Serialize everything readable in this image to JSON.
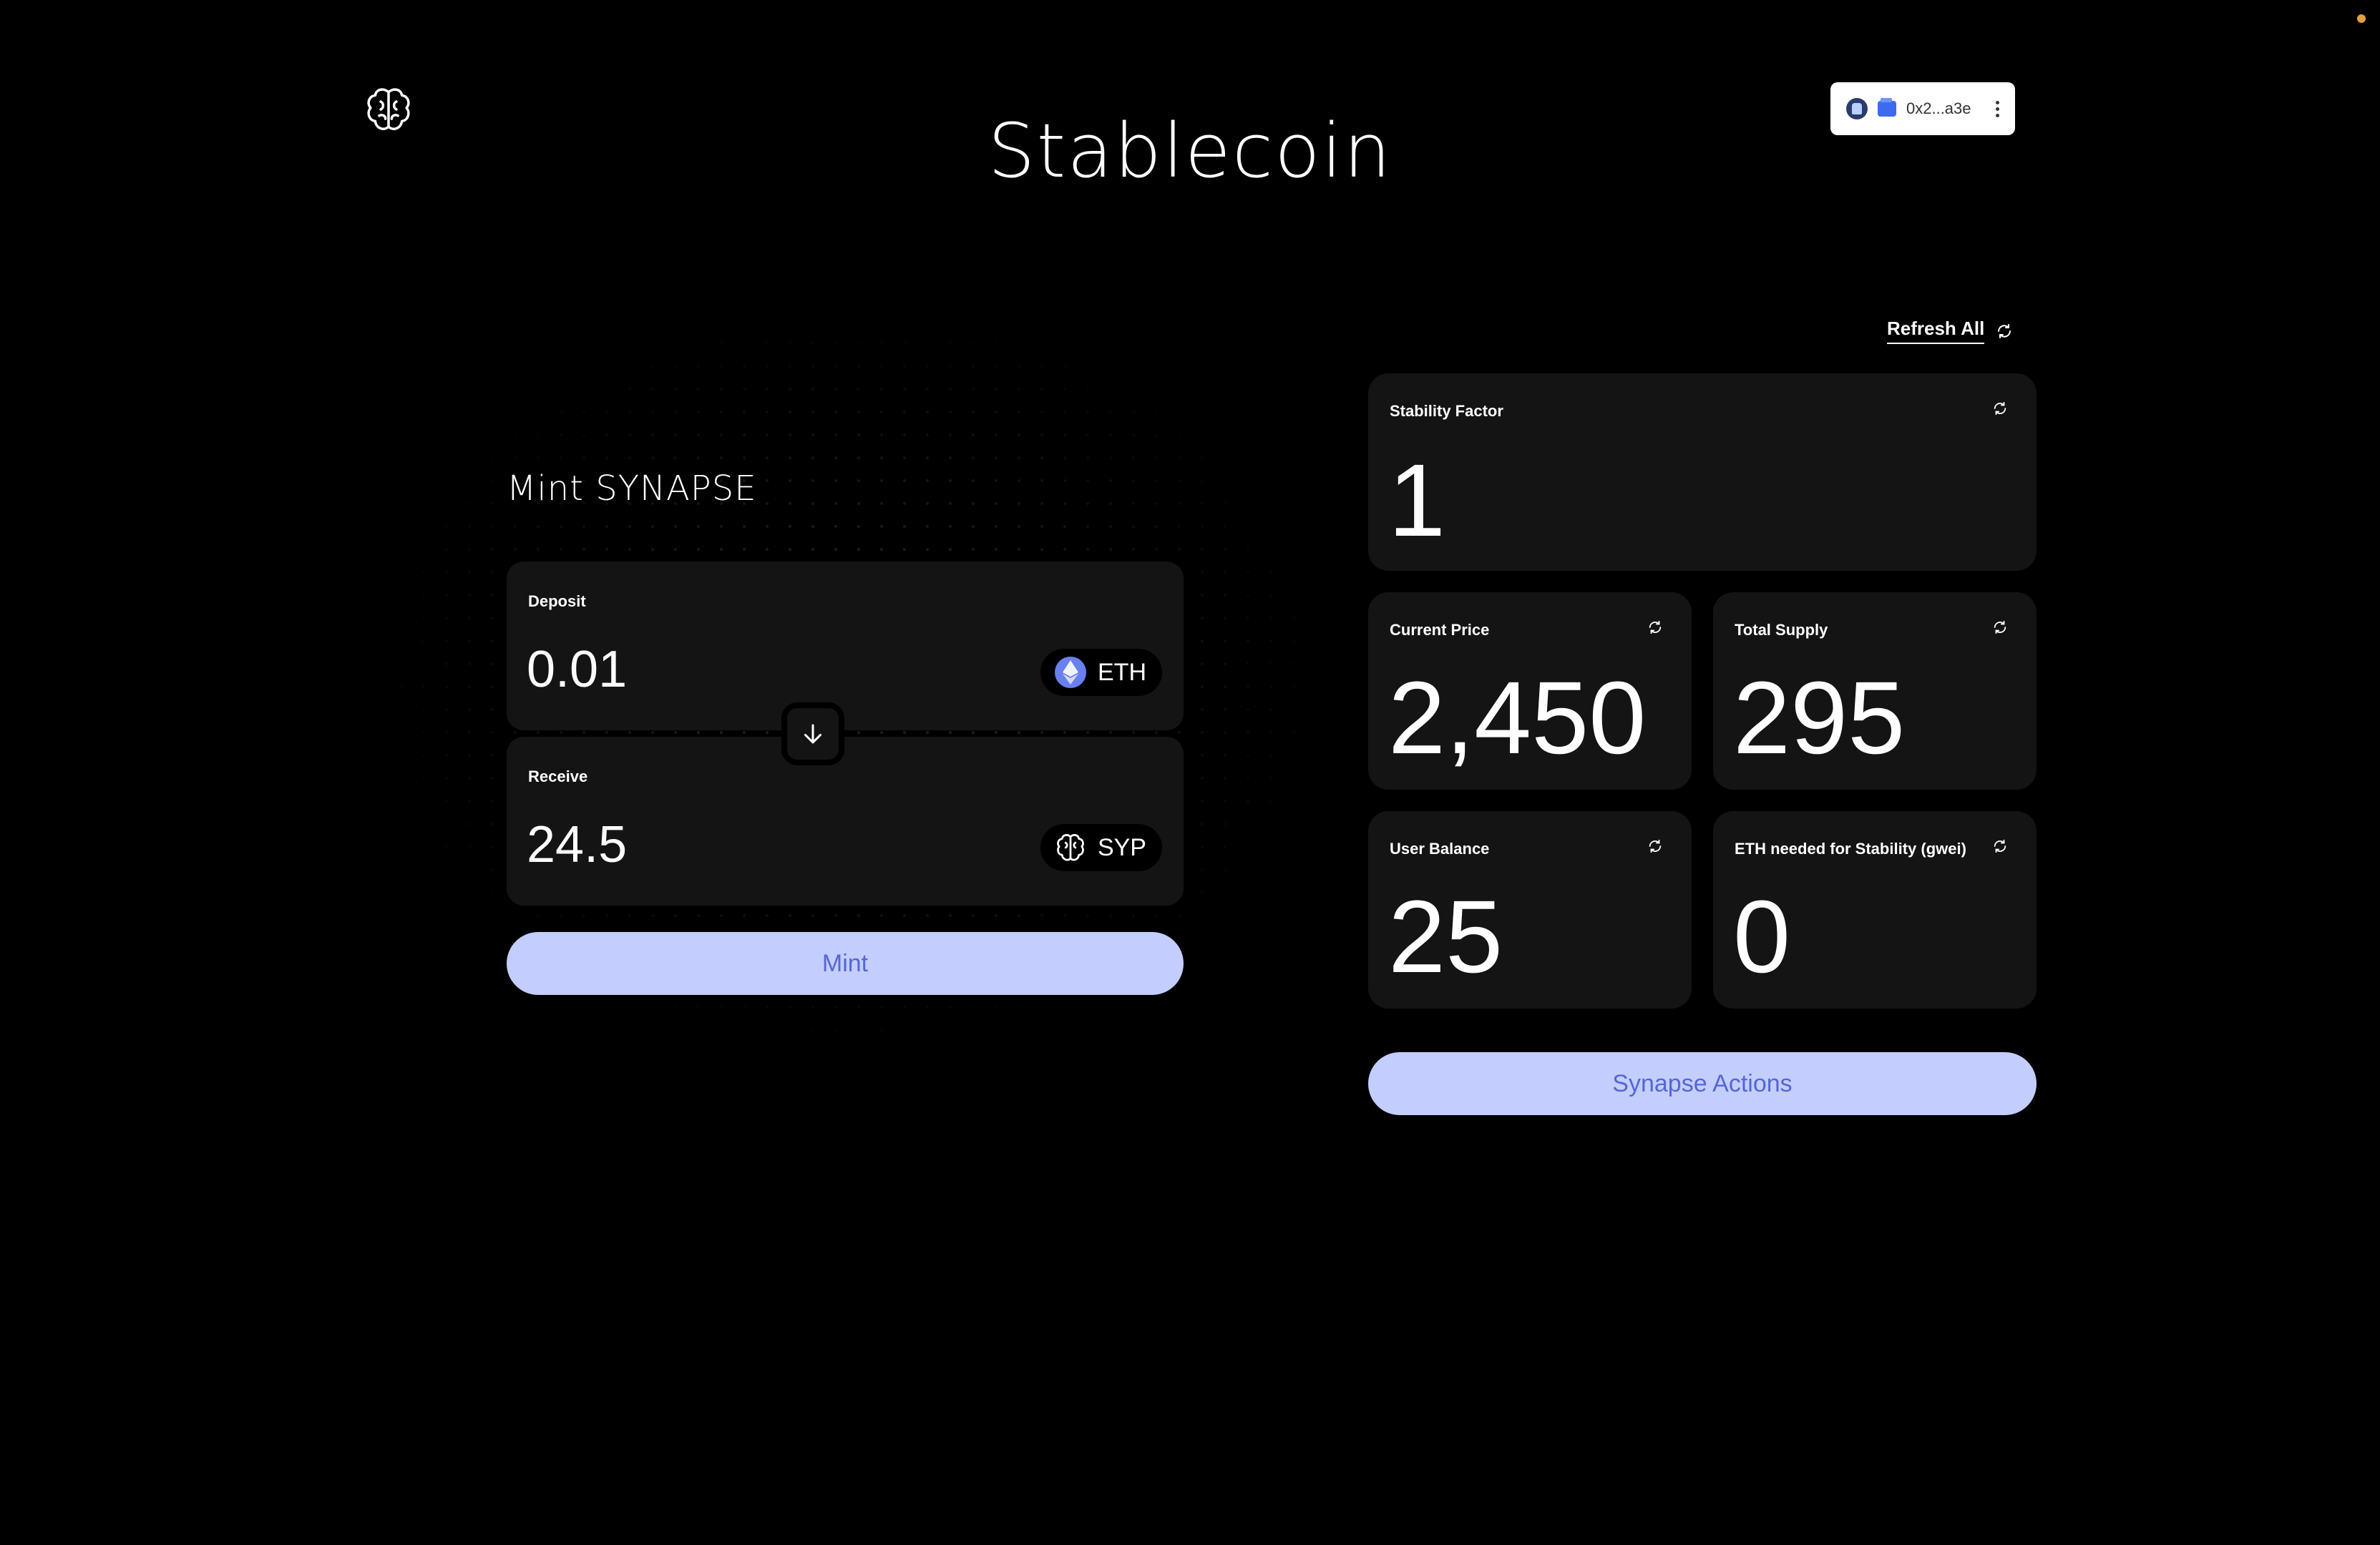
{
  "header": {
    "title": "Stablecoin",
    "wallet_address": "0x2...a3e"
  },
  "mint": {
    "title": "Mint SYNAPSE",
    "deposit": {
      "label": "Deposit",
      "value": "0.01",
      "token": "ETH"
    },
    "receive": {
      "label": "Receive",
      "value": "24.5",
      "token": "SYP"
    },
    "mint_button": "Mint"
  },
  "stats": {
    "refresh_all": "Refresh All",
    "stability_factor": {
      "label": "Stability Factor",
      "value": "1"
    },
    "current_price": {
      "label": "Current Price",
      "value": "2,450"
    },
    "total_supply": {
      "label": "Total Supply",
      "value": "295"
    },
    "user_balance": {
      "label": "User Balance",
      "value": "25"
    },
    "eth_needed": {
      "label": "ETH needed for Stability (gwei)",
      "value": "0"
    },
    "actions_button": "Synapse Actions"
  },
  "colors": {
    "background": "#000000",
    "card": "#141414",
    "accent_button": "#c3ceff",
    "accent_text": "#5566d6"
  },
  "icons": [
    "brain-logo-icon",
    "wallet-icon",
    "kebab-menu-icon",
    "eth-icon",
    "arrow-down-icon",
    "refresh-icon"
  ]
}
